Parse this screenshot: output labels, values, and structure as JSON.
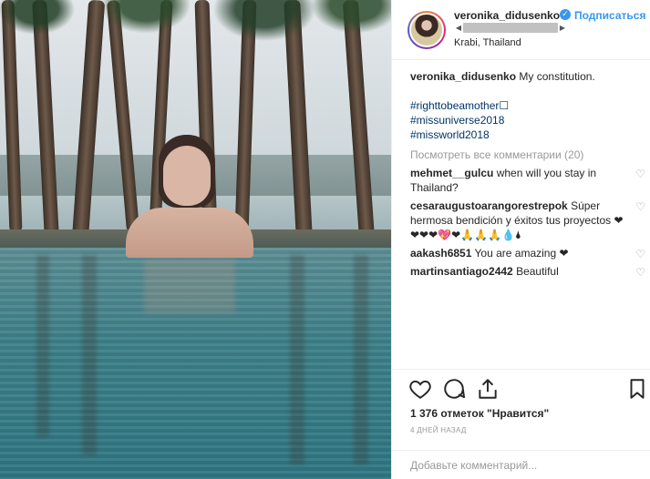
{
  "post": {
    "username": "veronika_didusenko",
    "follow_label": "Подписаться",
    "location": "Krabi, Thailand",
    "verified_icon": "verified-badge-icon"
  },
  "caption": {
    "username": "veronika_didusenko",
    "text": "My constitution.",
    "hashtags": [
      "#righttobeamother☐",
      "#missuniverse2018",
      "#missworld2018"
    ]
  },
  "view_all_comments": "Посмотреть все комментарии (20)",
  "comments": [
    {
      "username": "mehmet__gulcu",
      "text": "when will you stay in Thailand?"
    },
    {
      "username": "cesaraugustoarangorestrepok",
      "text": "Súper hermosa bendición y éxitos tus proyectos ❤❤❤❤💖❤🙏🙏🙏💧🌢"
    },
    {
      "username": "aakash6851",
      "text": "You are amazing ❤"
    },
    {
      "username": "martinsantiago2442",
      "text": "Beautiful"
    }
  ],
  "likes_text": "1 376 отметок \"Нравится\"",
  "date_text": "4 ДНЕЙ НАЗАД",
  "add_comment_placeholder": "Добавьте комментарий..."
}
